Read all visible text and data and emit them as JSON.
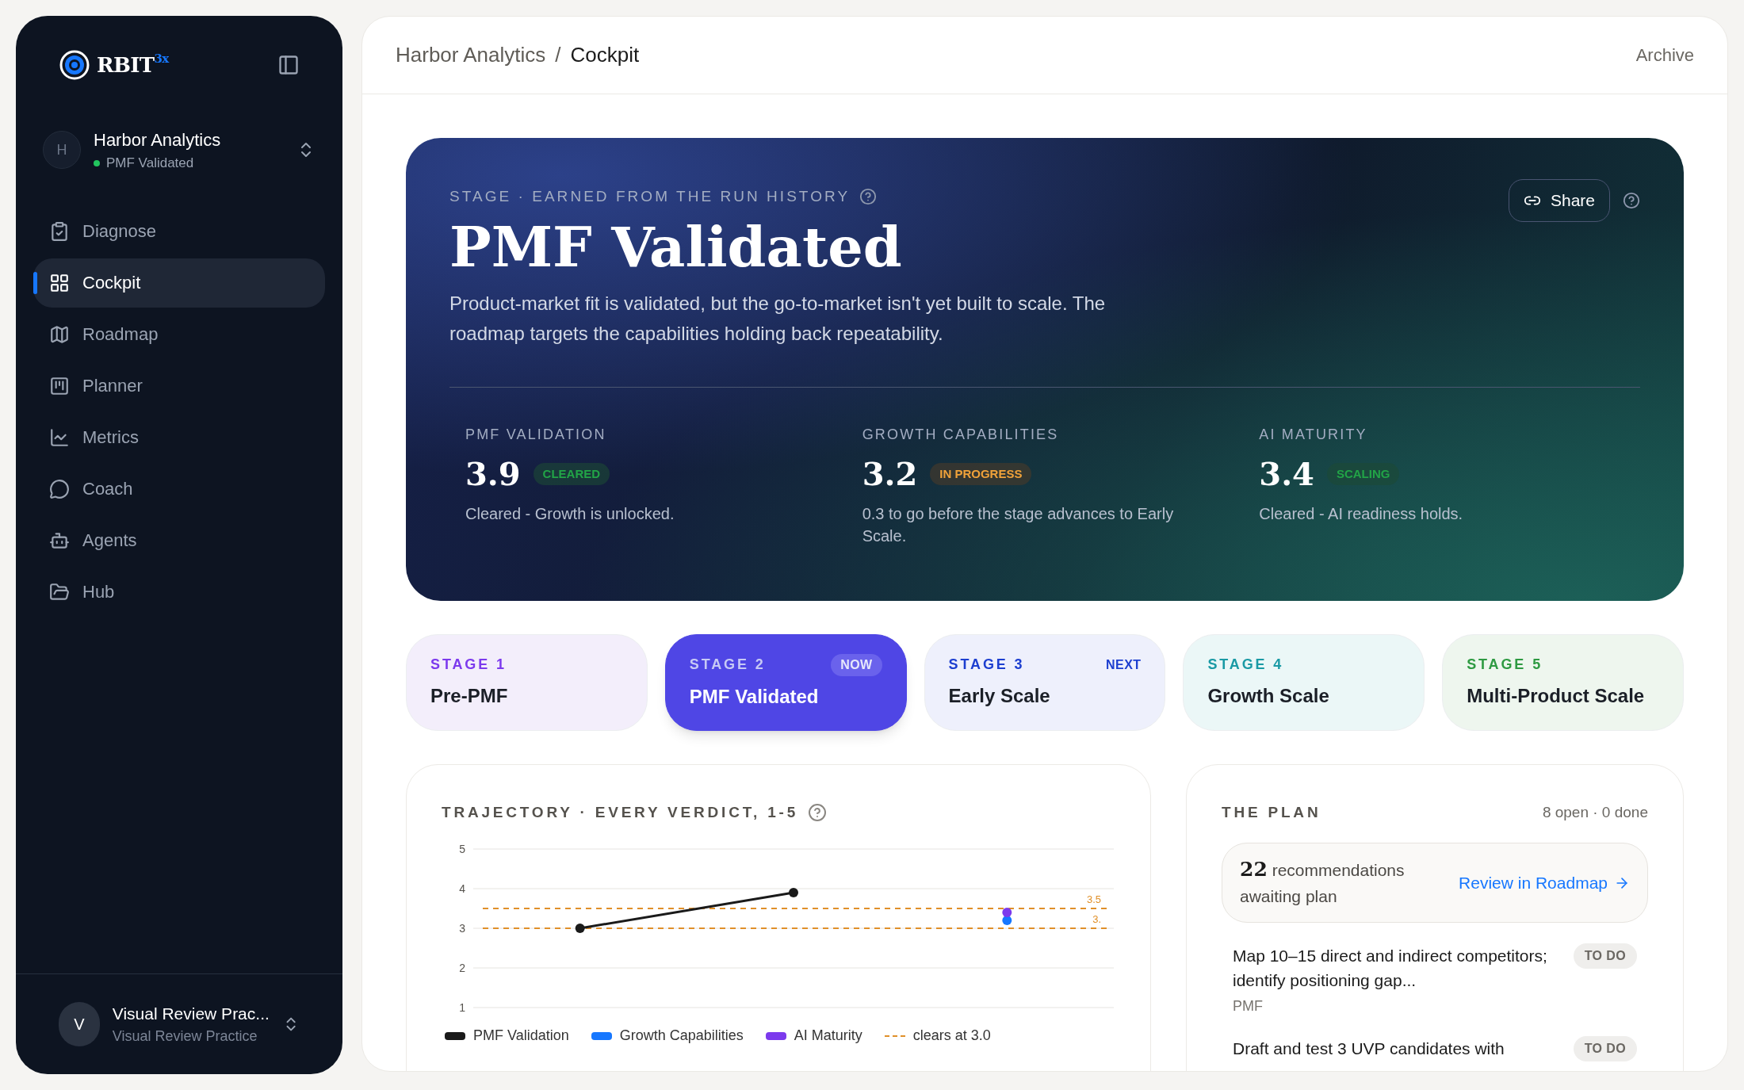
{
  "sidebar": {
    "logo": {
      "text": "RBIT",
      "superscript": "3x"
    },
    "workspace": {
      "initial": "H",
      "name": "Harbor Analytics",
      "status": "PMF Validated"
    },
    "items": [
      {
        "label": "Diagnose",
        "selected": false
      },
      {
        "label": "Cockpit",
        "selected": true
      },
      {
        "label": "Roadmap",
        "selected": false
      },
      {
        "label": "Planner",
        "selected": false
      },
      {
        "label": "Metrics",
        "selected": false
      },
      {
        "label": "Coach",
        "selected": false
      },
      {
        "label": "Agents",
        "selected": false
      },
      {
        "label": "Hub",
        "selected": false
      }
    ],
    "user": {
      "initial": "V",
      "name": "Visual Review Prac...",
      "org": "Visual Review Practice"
    }
  },
  "header": {
    "breadcrumb": [
      "Harbor Analytics",
      "/",
      "Cockpit"
    ],
    "action": "Archive"
  },
  "hero": {
    "eyebrow": "STAGE · EARNED FROM THE RUN HISTORY",
    "title": "PMF Validated",
    "description": "Product-market fit is validated, but the go-to-market isn't yet built to scale. The roadmap targets the capabilities holding back repeatability.",
    "share": "Share",
    "metrics": [
      {
        "label": "PMF VALIDATION",
        "value": "3.9",
        "status": "CLEARED",
        "kind": "good",
        "note": "Cleared - Growth is unlocked."
      },
      {
        "label": "GROWTH CAPABILITIES",
        "value": "3.2",
        "status": "IN PROGRESS",
        "kind": "warn",
        "note": "0.3 to go before the stage advances to Early Scale."
      },
      {
        "label": "AI MATURITY",
        "value": "3.4",
        "status": "SCALING",
        "kind": "good",
        "note": "Cleared - AI readiness holds."
      }
    ]
  },
  "stages": [
    {
      "label": "STAGE 1",
      "name": "Pre-PMF",
      "color": "#7c3aed",
      "selected": false
    },
    {
      "label": "STAGE 2",
      "name": "PMF Validated",
      "badge": "NOW",
      "color": "#4f46e5",
      "selected": true
    },
    {
      "label": "STAGE 3",
      "name": "Early Scale",
      "badge": "NEXT",
      "color": "#1d3fd0",
      "selected": false
    },
    {
      "label": "STAGE 4",
      "name": "Growth Scale",
      "color": "#1a9aa5",
      "selected": false
    },
    {
      "label": "STAGE 5",
      "name": "Multi-Product Scale",
      "color": "#2e9a42",
      "selected": false
    }
  ],
  "trajectory": {
    "title": "TRAJECTORY · EVERY VERDICT, 1-5",
    "threshold_legend": "clears at 3.0",
    "chart_data": {
      "type": "line",
      "ylim": [
        1,
        5
      ],
      "yticks": [
        1,
        2,
        3,
        4,
        5
      ],
      "grid": true,
      "series": [
        {
          "name": "PMF Validation",
          "color": "#1a1a1a",
          "marker": "o",
          "values": [
            3.0,
            3.9,
            null
          ]
        },
        {
          "name": "Growth Capabilities",
          "color": "#1677ff",
          "marker": "o",
          "values": [
            null,
            null,
            3.2
          ]
        },
        {
          "name": "AI Maturity",
          "color": "#7c3aed",
          "marker": "o",
          "values": [
            null,
            null,
            3.4
          ]
        }
      ],
      "ref_lines": [
        {
          "axis": "y",
          "value": 3.5,
          "label": "3.5"
        },
        {
          "axis": "y",
          "value": 3.0,
          "label": "3."
        }
      ]
    }
  },
  "plan": {
    "title": "THE PLAN",
    "summary": "8 open · 0 done",
    "count": "22",
    "count_text": "recommendations awaiting plan",
    "link": "Review in Roadmap",
    "items": [
      {
        "title": "Map 10–15 direct and indirect competitors; identify positioning gap...",
        "tag": "PMF",
        "status": "TO DO"
      },
      {
        "title": "Draft and test 3 UVP candidates with",
        "status": "TO DO"
      }
    ]
  }
}
